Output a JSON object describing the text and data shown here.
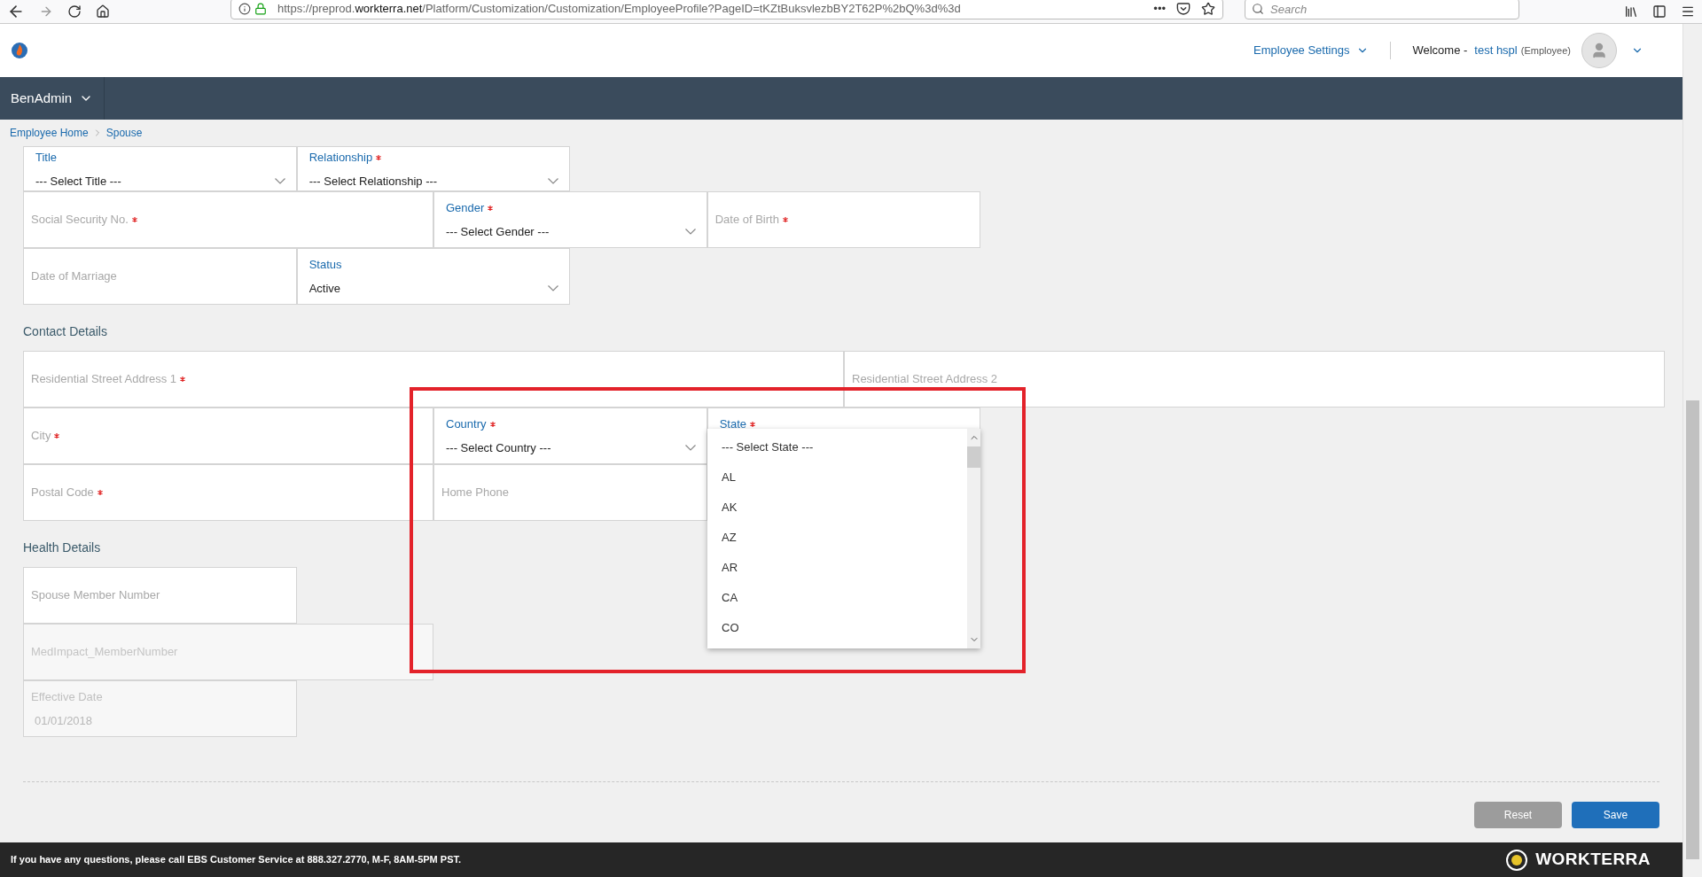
{
  "browser": {
    "url_prefix": "https://preprod.",
    "url_domain": "workterra.net",
    "url_path": "/Platform/Customization/Customization/EmployeeProfile?PageID=tKZtBuksvlezbBY2T62P%2bQ%3d%3d",
    "more": "•••",
    "search": {
      "placeholder": "Search"
    }
  },
  "header": {
    "settings_menu": "Employee Settings",
    "welcome": "Welcome -",
    "user_name": "test hspl",
    "user_role": "(Employee)"
  },
  "nav": {
    "menu": "BenAdmin"
  },
  "breadcrumb": [
    {
      "label": "Employee Home"
    },
    {
      "label": "Spouse"
    }
  ],
  "sections": [
    {
      "rows": [
        [
          {
            "kind": "select",
            "label": "Title",
            "required": false,
            "value": "--- Select Title ---"
          },
          {
            "kind": "select",
            "label": "Relationship",
            "required": true,
            "value": "--- Select Relationship ---"
          }
        ],
        [
          {
            "kind": "text",
            "label": "Social Security No.",
            "required": true
          },
          {
            "kind": "select",
            "label": "Gender",
            "required": true,
            "value": "--- Select Gender ---"
          },
          {
            "kind": "text",
            "label": "Date of Birth",
            "required": true
          }
        ],
        [
          {
            "kind": "text",
            "label": "Date of Marriage",
            "required": false
          },
          {
            "kind": "select",
            "label": "Status",
            "required": false,
            "value": "Active"
          }
        ]
      ]
    },
    {
      "title": "Contact Details",
      "rows": [
        [
          {
            "kind": "text",
            "label": "Residential Street Address 1",
            "required": true
          },
          {
            "kind": "text",
            "label": "Residential Street Address 2",
            "required": false
          }
        ],
        [
          {
            "kind": "text",
            "label": "City",
            "required": true
          },
          {
            "kind": "select",
            "label": "Country",
            "required": true,
            "value": "--- Select Country ---"
          },
          {
            "kind": "select",
            "label": "State",
            "required": true
          }
        ],
        [
          {
            "kind": "text",
            "label": "Postal Code",
            "required": true
          },
          {
            "kind": "text",
            "label": "Home Phone",
            "required": false
          }
        ]
      ]
    },
    {
      "title": "Health Details",
      "rows": [
        [
          {
            "kind": "text",
            "label": "Spouse Member Number",
            "required": false
          }
        ],
        [
          {
            "kind": "disabled",
            "label": "MedImpact_MemberNumber",
            "required": false
          }
        ],
        [
          {
            "kind": "dated",
            "label": "Effective Date",
            "required": false,
            "value": "01/01/2018"
          }
        ]
      ]
    }
  ],
  "state_dropdown": {
    "options": [
      "--- Select State ---",
      "AL",
      "AK",
      "AZ",
      "AR",
      "CA",
      "CO"
    ]
  },
  "buttons": [
    {
      "label": "Reset",
      "kind": "secondary"
    },
    {
      "label": "Save",
      "kind": "primary"
    }
  ],
  "footer": {
    "notice": "If you have any questions, please call EBS Customer Service at 888.327.2770, M-F, 8AM-5PM PST.",
    "brand": "WORKTERRA"
  }
}
